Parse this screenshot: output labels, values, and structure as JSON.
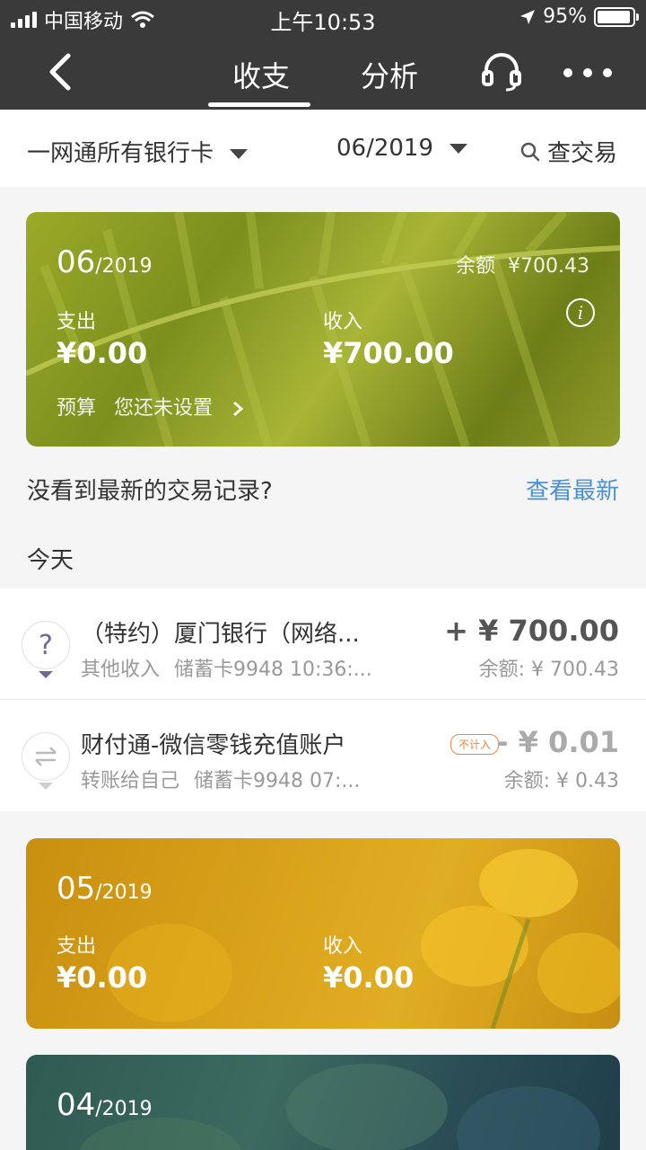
{
  "status_bar": {
    "carrier": "中国移动",
    "time": "上午10:53",
    "battery": "95%",
    "battery_level": 0.95
  },
  "nav": {
    "tab_active": "收支",
    "tab_other": "分析"
  },
  "filter": {
    "account": "一网通所有银行卡",
    "month": "06/2019",
    "search": "查交易"
  },
  "cards": [
    {
      "month": "06",
      "year": "/2019",
      "balance_label": "余额",
      "balance": "¥700.43",
      "expense_label": "支出",
      "expense": "¥0.00",
      "income_label": "收入",
      "income": "¥700.00",
      "budget_label": "预算",
      "budget_value": "您还未设置"
    },
    {
      "month": "05",
      "year": "/2019",
      "expense_label": "支出",
      "expense": "¥0.00",
      "income_label": "收入",
      "income": "¥0.00"
    },
    {
      "month": "04",
      "year": "/2019"
    }
  ],
  "prompt": {
    "text": "没看到最新的交易记录?",
    "action": "查看最新"
  },
  "section": {
    "today": "今天"
  },
  "transactions": [
    {
      "title": "（特约）厦门银行（网络...",
      "category": "其他收入",
      "meta": "储蓄卡9948 10:36:...",
      "amount": "+ ¥  700.00",
      "balance": "余额: ¥ 700.43"
    },
    {
      "title": "财付通-微信零钱充值账户",
      "category": "转账给自己",
      "meta": "储蓄卡9948 07:...",
      "tag": "不计入",
      "amount": "- ¥  0.01",
      "balance": "余额: ¥ 0.43"
    }
  ],
  "colors": {
    "topbar": "#3a3a3a",
    "link": "#4a90d9",
    "tag": "#e8883a"
  }
}
